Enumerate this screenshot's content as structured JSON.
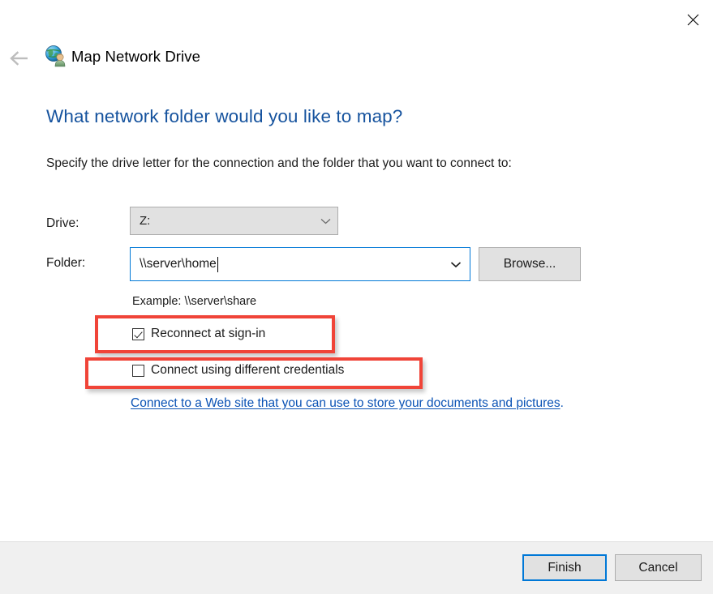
{
  "window": {
    "close_icon": "close-icon",
    "back_icon": "back-arrow-icon",
    "app_icon": "map-network-drive-icon",
    "title": "Map Network Drive"
  },
  "content": {
    "heading": "What network folder would you like to map?",
    "instruction": "Specify the drive letter for the connection and the folder that you want to connect to:",
    "drive": {
      "label": "Drive:",
      "value": "Z:",
      "chevron_icon": "chevron-down-icon"
    },
    "folder": {
      "label": "Folder:",
      "value": "\\\\server\\home",
      "placeholder": "",
      "chevron_icon": "chevron-down-icon",
      "browse_label": "Browse..."
    },
    "example": "Example: \\\\server\\share",
    "checkboxes": [
      {
        "label": "Reconnect at sign-in",
        "checked": true
      },
      {
        "label": "Connect using different credentials",
        "checked": false
      }
    ],
    "web_link": {
      "text": "Connect to a Web site that you can use to store your documents and pictures",
      "period": "."
    }
  },
  "footer": {
    "finish_label": "Finish",
    "cancel_label": "Cancel"
  },
  "colors": {
    "heading_blue": "#16539e",
    "link_blue": "#0b53b5",
    "focus_blue": "#0078d7",
    "annotation_red": "#f04438",
    "control_gray": "#e1e1e1",
    "footer_gray": "#f0f0f0"
  }
}
